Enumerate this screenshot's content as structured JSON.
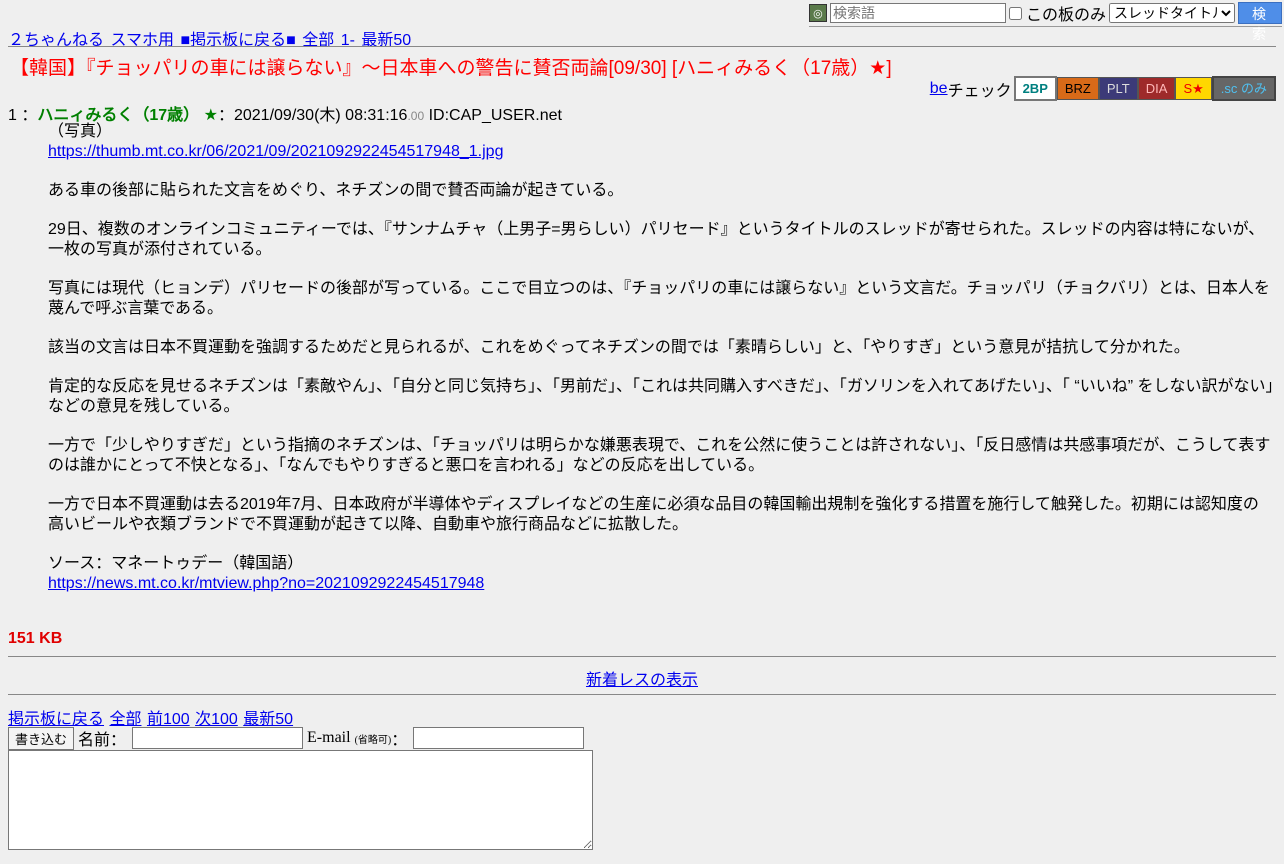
{
  "search": {
    "placeholder": "検索語",
    "board_only_label": "この板のみ",
    "select_value": "スレッドタイトル",
    "button_label": "検 索"
  },
  "topnav": {
    "items": [
      "２ちゃんねる",
      "スマホ用",
      "■掲示板に戻る■",
      "全部",
      "1-",
      "最新50"
    ]
  },
  "thread": {
    "title": "【韓国】『チョッパリの車には譲らない』～日本車への警告に賛否両論[09/30] [ハニィみるく（17歳）★]"
  },
  "becheck": {
    "be_link": "be",
    "label": "チェック",
    "badges": [
      "2BP",
      "BRZ",
      "PLT",
      "DIA",
      "S★",
      ".sc のみ"
    ]
  },
  "post": {
    "number": "1",
    "sep": "：",
    "name": "ハニィみるく（17歳） ★",
    "datetime": "2021/09/30(木) 08:31:16",
    "ms": ".00",
    "id": "ID:CAP_USER.net",
    "photo_label": "（写真）",
    "photo_url": "https://thumb.mt.co.kr/06/2021/09/2021092922454517948_1.jpg",
    "paragraphs": [
      "ある車の後部に貼られた文言をめぐり、ネチズンの間で賛否両論が起きている。",
      "29日、複数のオンラインコミュニティーでは、『サンナムチャ（上男子=男らしい）パリセード』というタイトルのスレッドが寄せられた。スレッドの内容は特にないが、一枚の写真が添付されている。",
      "写真には現代（ヒョンデ）パリセードの後部が写っている。ここで目立つのは、『チョッパリの車には譲らない』という文言だ。チョッパリ（チョクバリ）とは、日本人を蔑んで呼ぶ言葉である。",
      "該当の文言は日本不買運動を強調するためだと見られるが、これをめぐってネチズンの間では「素晴らしい」と、「やりすぎ」という意見が拮抗して分かれた。",
      "肯定的な反応を見せるネチズンは「素敵やん」、「自分と同じ気持ち」、「男前だ」、「これは共同購入すべきだ」、「ガソリンを入れてあげたい」、「 “いいね” をしない訳がない」などの意見を残している。",
      "一方で「少しやりすぎだ」という指摘のネチズンは、「チョッパリは明らかな嫌悪表現で、これを公然に使うことは許されない」、「反日感情は共感事項だが、こうして表すのは誰かにとって不快となる」、「なんでもやりすぎると悪口を言われる」などの反応を出している。",
      "一方で日本不買運動は去る2019年7月、日本政府が半導体やディスプレイなどの生産に必須な品目の韓国輸出規制を強化する措置を施行して触発した。初期には認知度の高いビールや衣類ブランドで不買運動が起きて以降、自動車や旅行商品などに拡散した。"
    ],
    "source_label": "ソース：マネートゥデー（韓国語）",
    "source_url": "https://news.mt.co.kr/mtview.php?no=2021092922454517948"
  },
  "filesize": "151 KB",
  "new_res_link": "新着レスの表示",
  "bottomnav": {
    "items": [
      "掲示板に戻る",
      "全部",
      "前100",
      "次100",
      "最新50"
    ]
  },
  "form": {
    "write_button": "書き込む",
    "name_label": "名前：",
    "email_label": "E-mail",
    "email_optional": "(省略可)",
    "email_colon": "："
  },
  "colors": {
    "background": "#efefef",
    "title_red": "#ff0000",
    "name_green": "#008000",
    "link_blue": "#0000ee",
    "search_button": "#4f8ee8"
  }
}
